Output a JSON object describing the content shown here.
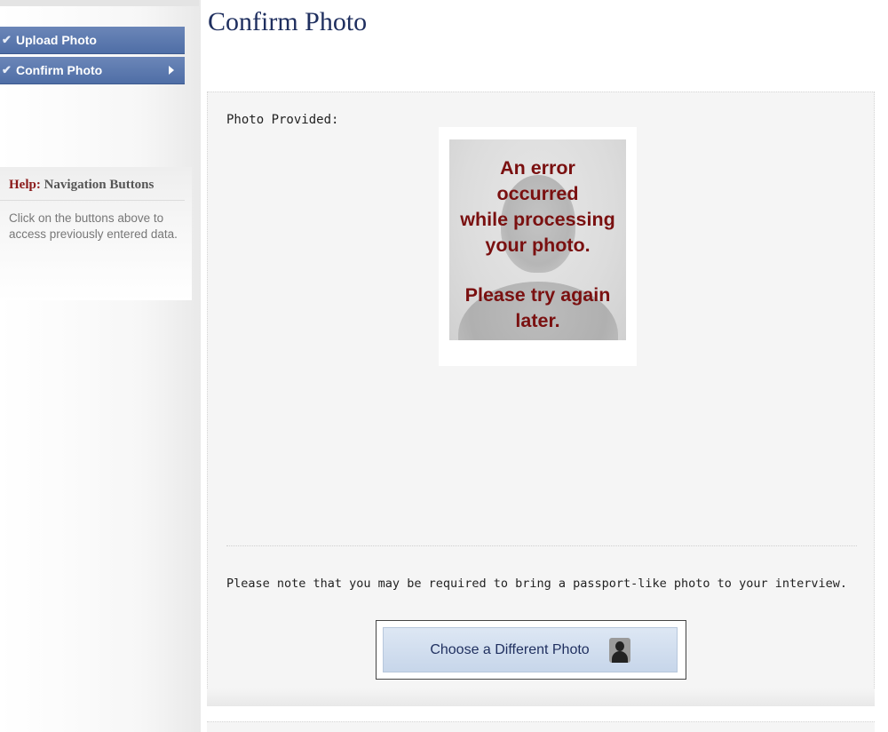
{
  "sidebar": {
    "nav": [
      {
        "label": "Upload Photo",
        "check": "✔"
      },
      {
        "label": "Confirm Photo",
        "check": "✔"
      }
    ],
    "help": {
      "prefix": "Help:",
      "title": "Navigation Buttons",
      "text": "Click on the buttons above to access previously entered data."
    }
  },
  "main": {
    "title": "Confirm Photo",
    "photo_label": "Photo Provided:",
    "photo_error": {
      "line1": "An error",
      "line2": "occurred",
      "line3": "while processing",
      "line4": "your photo.",
      "line5": "Please try again",
      "line6": "later."
    },
    "note": "Please note that you may be required to bring a passport-like photo to your interview.",
    "choose_button": {
      "label": "Choose a Different Photo",
      "icon": "person-silhouette-icon"
    }
  },
  "colors": {
    "nav_blue": "#5676ad",
    "title_navy": "#1f2f5f",
    "error_red": "#7a1010",
    "help_red": "#8b1a1a"
  }
}
